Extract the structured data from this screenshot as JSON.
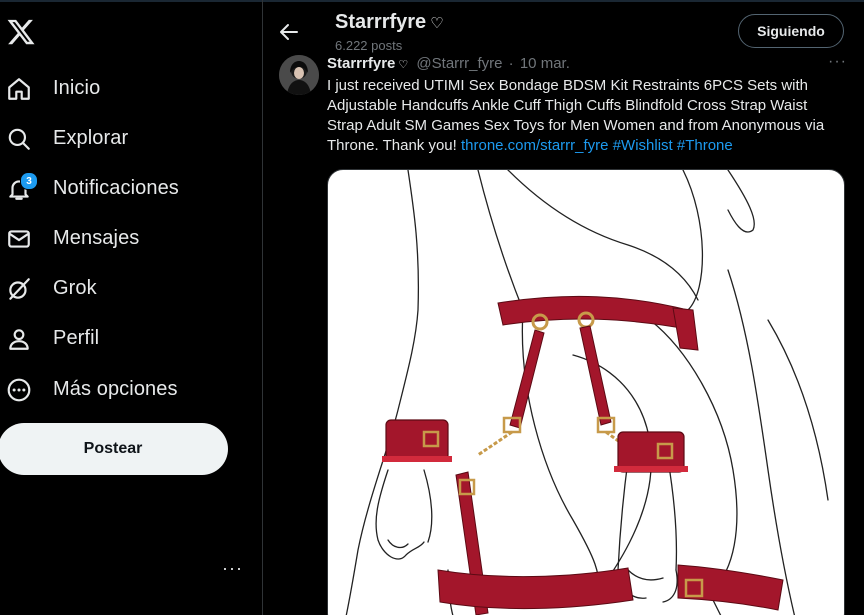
{
  "nav": {
    "items": [
      {
        "label": "Inicio",
        "icon": "home-icon"
      },
      {
        "label": "Explorar",
        "icon": "search-icon"
      },
      {
        "label": "Notificaciones",
        "icon": "bell-icon",
        "badge": "3"
      },
      {
        "label": "Mensajes",
        "icon": "mail-icon"
      },
      {
        "label": "Grok",
        "icon": "grok-icon"
      },
      {
        "label": "Perfil",
        "icon": "person-icon"
      },
      {
        "label": "Más opciones",
        "icon": "more-circle-icon"
      }
    ],
    "post_button": "Postear",
    "more": "···"
  },
  "header": {
    "name": "Starrrfyre",
    "heart": "♡",
    "post_count": "6.222 posts",
    "follow_button": "Siguiendo"
  },
  "tweet": {
    "display_name": "Starrrfyre",
    "heart": "♡",
    "handle": "@Starrr_fyre",
    "separator": "·",
    "date": "10 mar.",
    "more": "···",
    "text": "I just received UTIMI Sex Bondage BDSM Kit Restraints 6PCS Sets with Adjustable Handcuffs Ankle Cuff Thigh Cuffs Blindfold Cross Strap Waist Strap Adult SM Games Sex Toys for Men Women and from Anonymous via Throne. Thank you! ",
    "link": "throne.com/starrr_fyre",
    "hashtag1": "#Wishlist",
    "hashtag2": "#Throne"
  },
  "colors": {
    "accent": "#1d9bf0",
    "background": "#000000",
    "text": "#e7e9ea",
    "muted": "#71767b",
    "strap": "#a3162b"
  }
}
